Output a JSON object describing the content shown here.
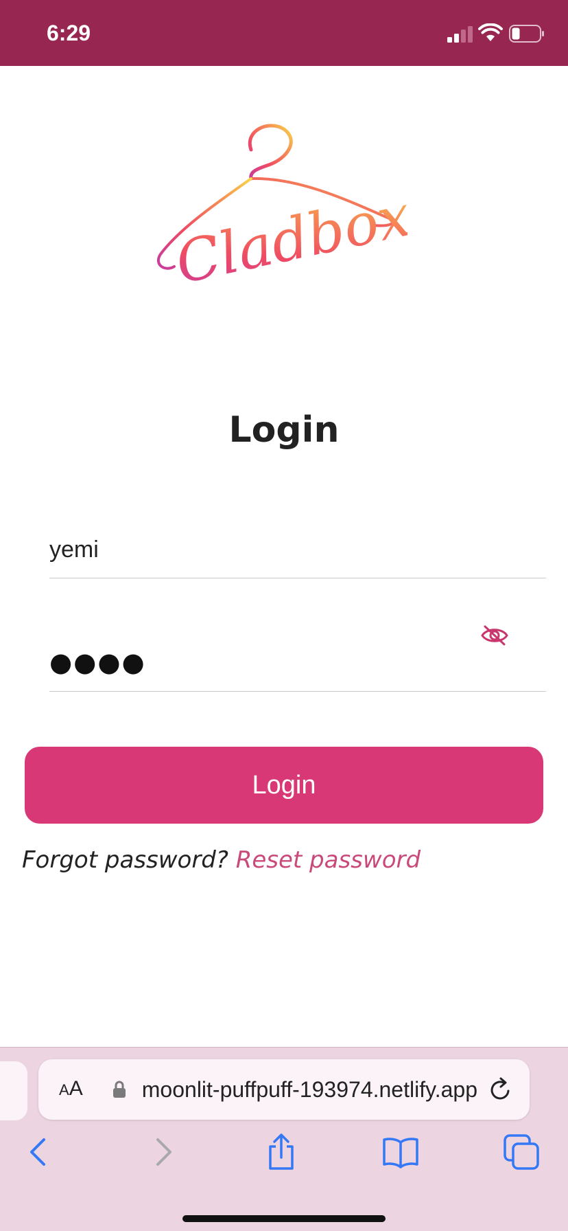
{
  "status_bar": {
    "time": "6:29",
    "background_color": "#972651",
    "icons": [
      "cellular-signal-icon",
      "wifi-icon",
      "battery-icon"
    ]
  },
  "logo": {
    "wordmark": "Cladbox",
    "icon": "hanger-logo-icon"
  },
  "login_form": {
    "title": "Login",
    "username_value": "yemi",
    "password_masked": "●●●●",
    "toggle_icon": "eye-slash-icon",
    "submit_label": "Login",
    "forgot_text": "Forgot password?",
    "reset_link": "Reset password",
    "accent_color": "#d93876"
  },
  "browser": {
    "aa_label_small": "A",
    "aa_label_large": "A",
    "url": "moonlit-puffpuff-193974.netlify.app",
    "icons": [
      "lock-icon",
      "reload-icon",
      "back-icon",
      "forward-icon",
      "share-icon",
      "bookmarks-icon",
      "tabs-icon"
    ]
  }
}
